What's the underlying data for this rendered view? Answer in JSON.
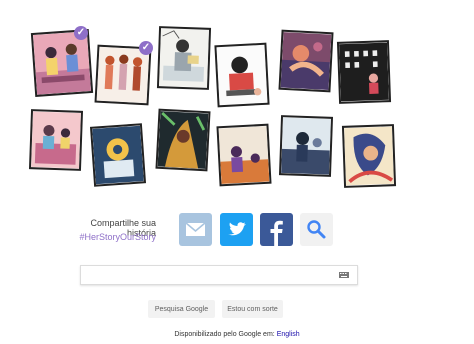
{
  "share": {
    "label": "Compartilhe sua história",
    "hashtag": "#HerStoryOurStory",
    "buttons": [
      {
        "name": "email",
        "icon": "email-icon",
        "color": "#a8c4df"
      },
      {
        "name": "twitter",
        "icon": "twitter-icon",
        "color": "#1da1f2"
      },
      {
        "name": "facebook",
        "icon": "facebook-icon",
        "color": "#3b5998"
      },
      {
        "name": "search",
        "icon": "search-icon",
        "color": "#f1f1f1"
      }
    ]
  },
  "search": {
    "value": "",
    "placeholder": ""
  },
  "buttons": {
    "search_label": "Pesquisa Google",
    "lucky_label": "Estou com sorte"
  },
  "footer": {
    "offered_text": "Disponibilizado pelo Google em:",
    "language_link": "English"
  },
  "doodle": {
    "cards": [
      {
        "name": "story-card-1",
        "checked": true
      },
      {
        "name": "story-card-2",
        "checked": true
      },
      {
        "name": "story-card-3",
        "checked": false
      },
      {
        "name": "story-card-4",
        "checked": false
      },
      {
        "name": "story-card-5",
        "checked": false
      },
      {
        "name": "story-card-6",
        "checked": false
      },
      {
        "name": "story-card-7",
        "checked": false
      },
      {
        "name": "story-card-8",
        "checked": false
      },
      {
        "name": "story-card-9",
        "checked": false
      },
      {
        "name": "story-card-10",
        "checked": false
      },
      {
        "name": "story-card-11",
        "checked": false
      },
      {
        "name": "story-card-12",
        "checked": false
      }
    ]
  }
}
